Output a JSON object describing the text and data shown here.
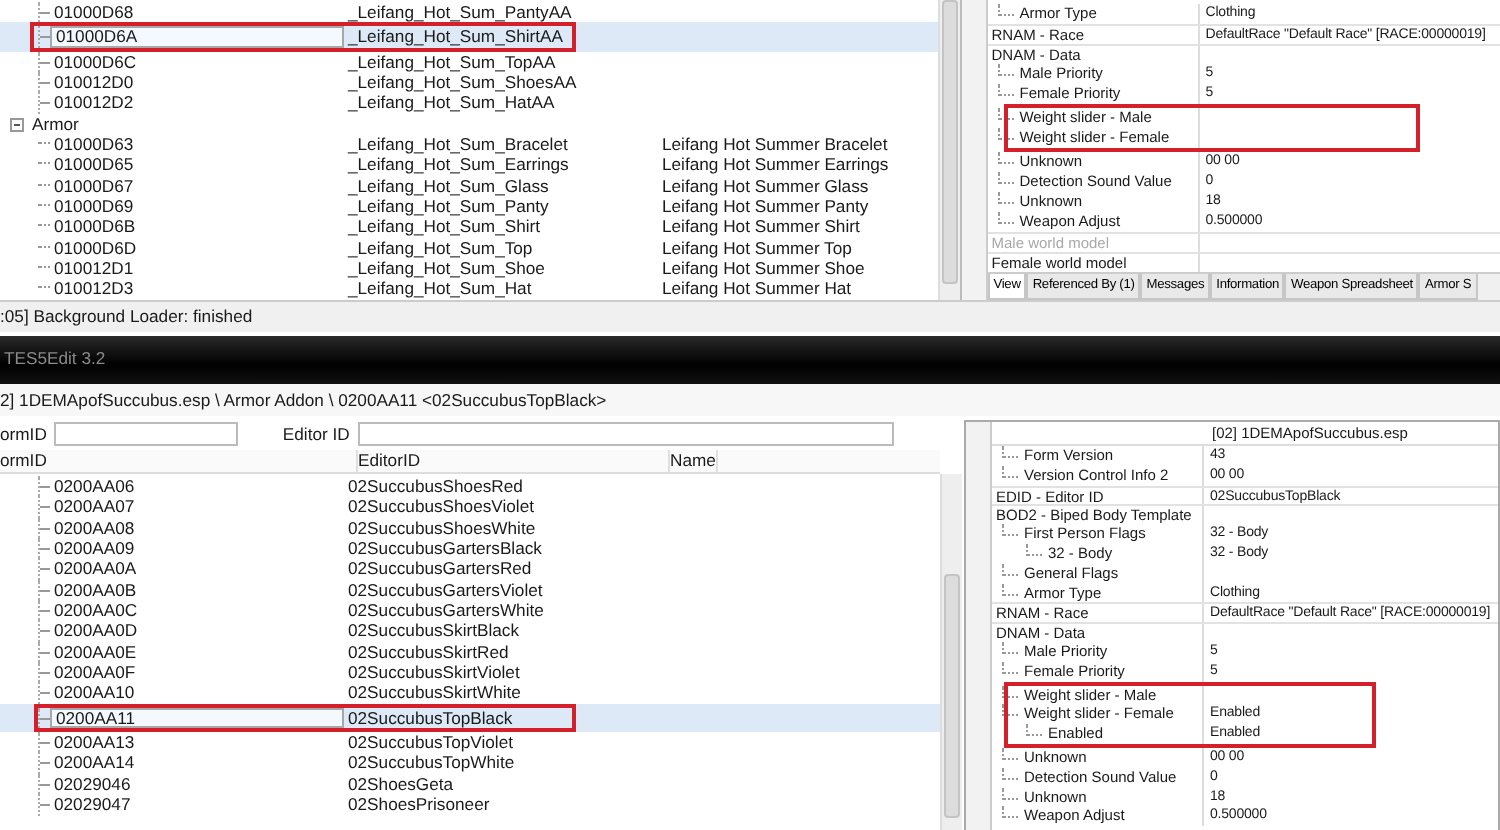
{
  "top_list": {
    "rows": [
      {
        "kind": "continued",
        "children": [
          {
            "kind": "record",
            "form_id": "01000D68",
            "editor_id": "_Leifang_Hot_Sum_PantyAA",
            "selected": false,
            "highlighted": false
          },
          {
            "kind": "record",
            "form_id": "01000D6A",
            "editor_id": "_Leifang_Hot_Sum_ShirtAA",
            "selected": true,
            "highlighted": true
          },
          {
            "kind": "record",
            "form_id": "01000D6C",
            "editor_id": "_Leifang_Hot_Sum_TopAA",
            "selected": false,
            "highlighted": false
          },
          {
            "kind": "record",
            "form_id": "010012D0",
            "editor_id": "_Leifang_Hot_Sum_ShoesAA",
            "selected": false,
            "highlighted": false
          },
          {
            "kind": "record",
            "form_id": "010012D2",
            "editor_id": "_Leifang_Hot_Sum_HatAA",
            "selected": false,
            "highlighted": false
          }
        ]
      },
      {
        "kind": "group",
        "label": "Armor",
        "expanded": true,
        "children": [
          {
            "kind": "record",
            "form_id": "01000D63",
            "editor_id": "_Leifang_Hot_Sum_Bracelet",
            "name": "Leifang Hot Summer Bracelet",
            "selected": false,
            "highlighted": false
          },
          {
            "kind": "record",
            "form_id": "01000D65",
            "editor_id": "_Leifang_Hot_Sum_Earrings",
            "name": "Leifang Hot Summer Earrings",
            "selected": false,
            "highlighted": false
          },
          {
            "kind": "record",
            "form_id": "01000D67",
            "editor_id": "_Leifang_Hot_Sum_Glass",
            "name": "Leifang Hot Summer Glass",
            "selected": false,
            "highlighted": false
          },
          {
            "kind": "record",
            "form_id": "01000D69",
            "editor_id": "_Leifang_Hot_Sum_Panty",
            "name": "Leifang Hot Summer Panty",
            "selected": false,
            "highlighted": false
          },
          {
            "kind": "record",
            "form_id": "01000D6B",
            "editor_id": "_Leifang_Hot_Sum_Shirt",
            "name": "Leifang Hot Summer Shirt",
            "selected": false,
            "highlighted": false
          },
          {
            "kind": "record",
            "form_id": "01000D6D",
            "editor_id": "_Leifang_Hot_Sum_Top",
            "name": "Leifang Hot Summer Top",
            "selected": false,
            "highlighted": false
          },
          {
            "kind": "record",
            "form_id": "010012D1",
            "editor_id": "_Leifang_Hot_Sum_Shoe",
            "name": "Leifang Hot Summer Shoe",
            "selected": false,
            "highlighted": false
          },
          {
            "kind": "record",
            "form_id": "010012D3",
            "editor_id": "_Leifang_Hot_Sum_Hat",
            "name": "Leifang Hot Summer Hat",
            "selected": false,
            "highlighted": false
          }
        ]
      }
    ]
  },
  "top_record": {
    "rows": [
      {
        "kind": "continued",
        "children": [
          {
            "label": "Armor Type",
            "value": "Clothing"
          }
        ]
      },
      {
        "label": "RNAM - Race",
        "value": "DefaultRace \"Default Race\" [RACE:00000019]",
        "disabled": false
      },
      {
        "label": "DNAM - Data",
        "disabled": false,
        "children": [
          {
            "label": "Male Priority",
            "value": "5"
          },
          {
            "label": "Female Priority",
            "value": "5"
          },
          {
            "label": "Weight slider - Male",
            "highlighted": true
          },
          {
            "label": "Weight slider - Female",
            "highlighted": true
          },
          {
            "label": "Unknown",
            "value": "00 00"
          },
          {
            "label": "Detection Sound Value",
            "value": "0"
          },
          {
            "label": "Unknown",
            "value": "18"
          },
          {
            "label": "Weapon Adjust",
            "value": "0.500000"
          }
        ]
      },
      {
        "label": "Male world model",
        "disabled": true
      },
      {
        "label": "Female world model",
        "disabled": false
      }
    ],
    "tabs": [
      {
        "label": "View",
        "selected": true
      },
      {
        "label": "Referenced By (1)",
        "selected": false
      },
      {
        "label": "Messages",
        "selected": false
      },
      {
        "label": "Information",
        "selected": false
      },
      {
        "label": "Weapon Spreadsheet",
        "selected": false
      },
      {
        "label": "Armor S",
        "selected": false
      }
    ]
  },
  "status_bar": ":05] Background Loader: finished",
  "window": {
    "title": "TES5Edit 3.2"
  },
  "path": "2] 1DEMApofSuccubus.esp \\ Armor Addon \\ 0200AA11 <02SuccubusTopBlack>",
  "filter": {
    "form_id_label": "ormID",
    "editor_id_label": "Editor ID"
  },
  "bottom_list": {
    "columns": [
      "ormID",
      "EditorID",
      "Name"
    ],
    "rows": [
      {
        "kind": "continued",
        "children": [
          {
            "kind": "record",
            "form_id": "0200AA06",
            "editor_id": "02SuccubusShoesRed",
            "selected": false,
            "highlighted": false
          },
          {
            "kind": "record",
            "form_id": "0200AA07",
            "editor_id": "02SuccubusShoesViolet",
            "selected": false,
            "highlighted": false
          },
          {
            "kind": "record",
            "form_id": "0200AA08",
            "editor_id": "02SuccubusShoesWhite",
            "selected": false,
            "highlighted": false
          },
          {
            "kind": "record",
            "form_id": "0200AA09",
            "editor_id": "02SuccubusGartersBlack",
            "selected": false,
            "highlighted": false
          },
          {
            "kind": "record",
            "form_id": "0200AA0A",
            "editor_id": "02SuccubusGartersRed",
            "selected": false,
            "highlighted": false
          },
          {
            "kind": "record",
            "form_id": "0200AA0B",
            "editor_id": "02SuccubusGartersViolet",
            "selected": false,
            "highlighted": false
          },
          {
            "kind": "record",
            "form_id": "0200AA0C",
            "editor_id": "02SuccubusGartersWhite",
            "selected": false,
            "highlighted": false
          },
          {
            "kind": "record",
            "form_id": "0200AA0D",
            "editor_id": "02SuccubusSkirtBlack",
            "selected": false,
            "highlighted": false
          },
          {
            "kind": "record",
            "form_id": "0200AA0E",
            "editor_id": "02SuccubusSkirtRed",
            "selected": false,
            "highlighted": false
          },
          {
            "kind": "record",
            "form_id": "0200AA0F",
            "editor_id": "02SuccubusSkirtViolet",
            "selected": false,
            "highlighted": false
          },
          {
            "kind": "record",
            "form_id": "0200AA10",
            "editor_id": "02SuccubusSkirtWhite",
            "selected": false,
            "highlighted": false
          },
          {
            "kind": "record",
            "form_id": "0200AA11",
            "editor_id": "02SuccubusTopBlack",
            "selected": true,
            "highlighted": true
          },
          {
            "kind": "record",
            "form_id": "0200AA13",
            "editor_id": "02SuccubusTopViolet",
            "selected": false,
            "highlighted": false
          },
          {
            "kind": "record",
            "form_id": "0200AA14",
            "editor_id": "02SuccubusTopWhite",
            "selected": false,
            "highlighted": false
          },
          {
            "kind": "record",
            "form_id": "02029046",
            "editor_id": "02ShoesGeta",
            "selected": false,
            "highlighted": false
          },
          {
            "kind": "record",
            "form_id": "02029047",
            "editor_id": "02ShoesPrisoneer",
            "selected": false,
            "highlighted": false
          }
        ]
      }
    ]
  },
  "bottom_record": {
    "header": "[02] 1DEMApofSuccubus.esp",
    "rows": [
      {
        "kind": "continued",
        "children": [
          {
            "label": "Form Version",
            "value": "43"
          },
          {
            "label": "Version Control Info 2",
            "value": "00 00"
          }
        ]
      },
      {
        "label": "EDID - Editor ID",
        "value": "02SuccubusTopBlack"
      },
      {
        "label": "BOD2 - Biped Body Template",
        "children": [
          {
            "label": "First Person Flags",
            "value": "32 - Body",
            "children": [
              {
                "label": "32 - Body",
                "value": "32 - Body"
              }
            ]
          },
          {
            "label": "General Flags"
          },
          {
            "label": "Armor Type",
            "value": "Clothing"
          }
        ]
      },
      {
        "label": "RNAM - Race",
        "value": "DefaultRace \"Default Race\" [RACE:00000019]"
      },
      {
        "label": "DNAM - Data",
        "children": [
          {
            "label": "Male Priority",
            "value": "5"
          },
          {
            "label": "Female Priority",
            "value": "5"
          },
          {
            "label": "Weight slider - Male",
            "highlighted": true
          },
          {
            "label": "Weight slider - Female",
            "value": "Enabled",
            "highlighted": true,
            "children": [
              {
                "label": "Enabled",
                "value": "Enabled",
                "highlighted": true
              }
            ]
          },
          {
            "label": "Unknown",
            "value": "00 00"
          },
          {
            "label": "Detection Sound Value",
            "value": "0"
          },
          {
            "label": "Unknown",
            "value": "18"
          },
          {
            "label": "Weapon Adjust",
            "value": "0.500000"
          }
        ]
      }
    ]
  }
}
